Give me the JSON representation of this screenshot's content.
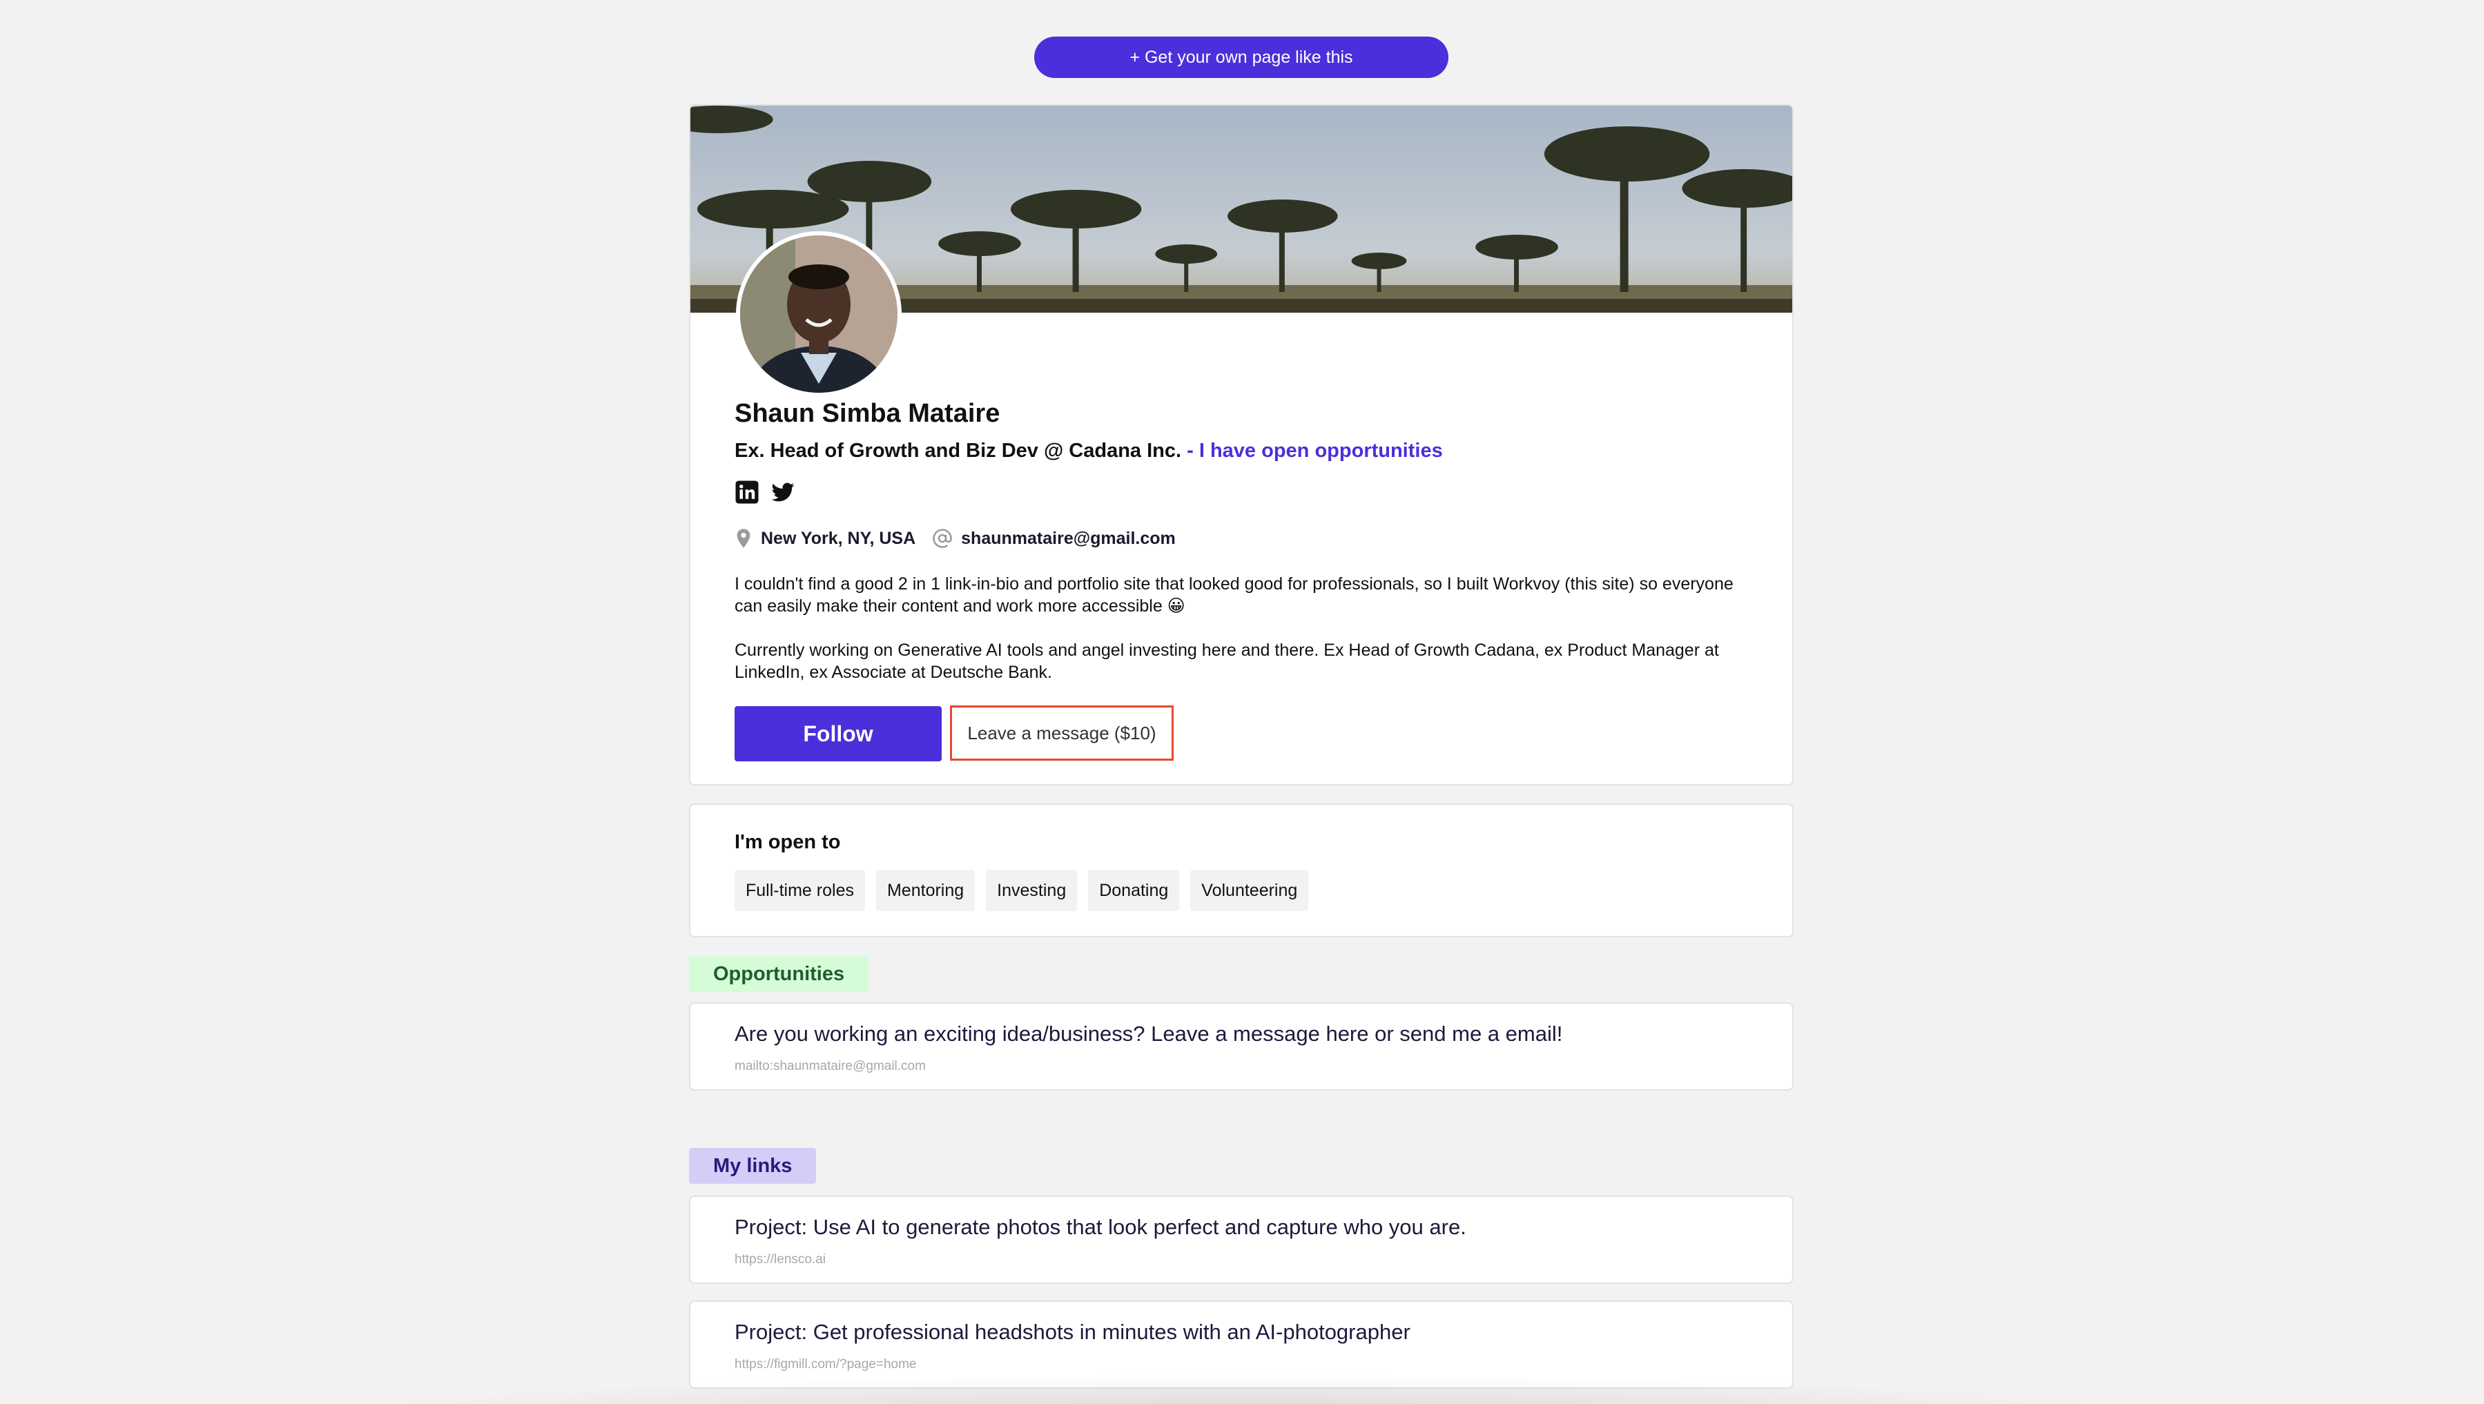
{
  "top_cta": {
    "label": "+ Get your own page like this"
  },
  "profile": {
    "name": "Shaun Simba Mataire",
    "headline": "Ex. Head of Growth and Biz Dev @ Cadana Inc.",
    "headline_separator": " - ",
    "opportunity_link": "I have open opportunities",
    "socials": [
      "linkedin-icon",
      "twitter-icon"
    ],
    "location": "New York, NY, USA",
    "email": "shaunmataire@gmail.com",
    "bio": [
      "I couldn't find a good 2 in 1 link-in-bio and portfolio site that looked good for professionals, so I built Workvoy (this site) so everyone can easily make their content and work more accessible 😀",
      "Currently working on Generative AI tools and angel investing here and there. Ex Head of Growth Cadana, ex Product Manager at LinkedIn, ex Associate at Deutsche Bank."
    ],
    "follow_label": "Follow",
    "message_label": "Leave a message ($10)"
  },
  "open_to": {
    "title": "I'm open to",
    "chips": [
      "Full-time roles",
      "Mentoring",
      "Investing",
      "Donating",
      "Volunteering"
    ]
  },
  "opportunities": {
    "tag": "Opportunities",
    "items": [
      {
        "title": "Are you working an exciting idea/business? Leave a message here or send me a email!",
        "url": "mailto:shaunmataire@gmail.com"
      }
    ]
  },
  "my_links": {
    "tag": "My links",
    "items": [
      {
        "title": "Project: Use AI to generate photos that look perfect and capture who you are.",
        "url": "https://lensco.ai"
      },
      {
        "title": "Project: Get professional headshots in minutes with an AI-photographer",
        "url": "https://figmill.com/?page=home"
      }
    ]
  },
  "colors": {
    "accent": "#4a2fdb",
    "background": "#f2f2f2",
    "message_border": "#e5492d"
  }
}
